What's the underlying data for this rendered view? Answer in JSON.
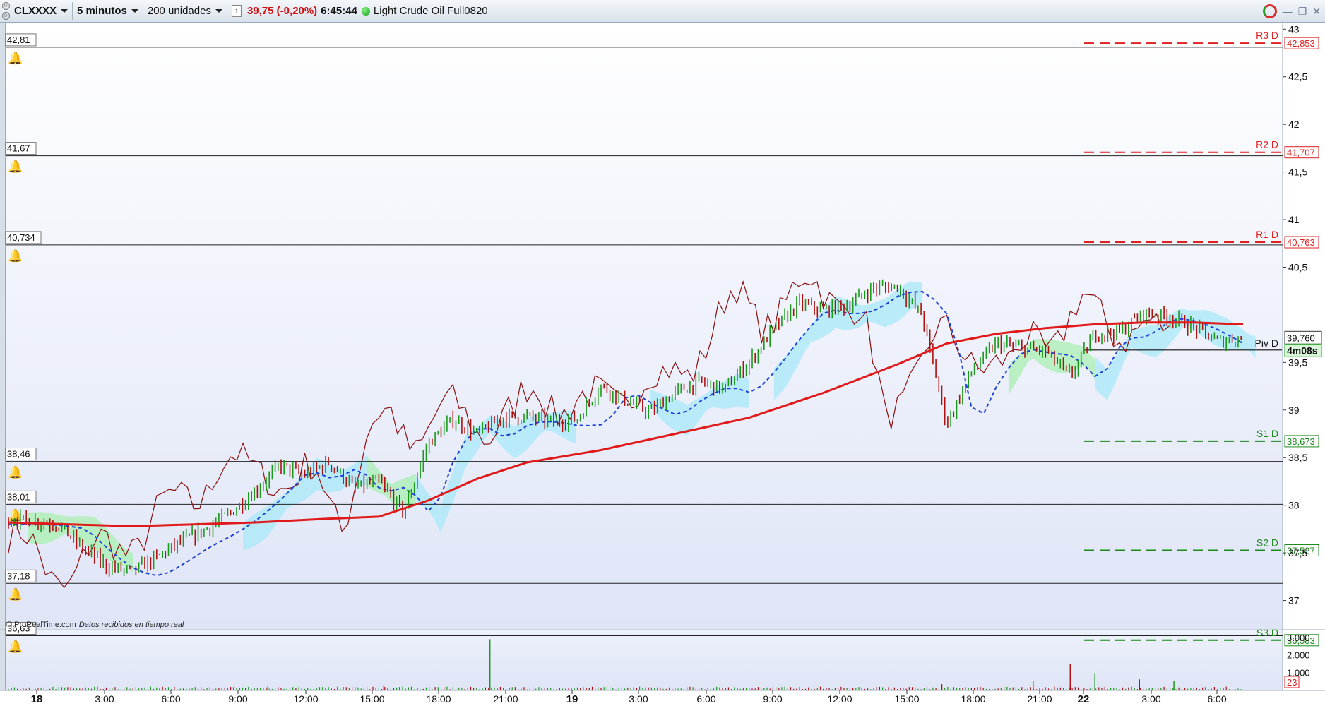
{
  "toolbar": {
    "instrument": "CLXXXX",
    "timeframe": "5 minutos",
    "units": "200 unidades",
    "info_icon": "i",
    "price_change": "39,75 (-0,20%)",
    "time": "6:45:44",
    "instrument_name": "Light Crude Oil Full0820"
  },
  "footer": {
    "copyright": "© ProRealTime.com",
    "realtime": "Datos recibidos en tiempo real"
  },
  "colors": {
    "candle_up": "#1a9a1a",
    "candle_down": "#b01010",
    "ma_200": "#e01a1a",
    "kijun": "#1a3fd8",
    "cloud_bull": "#a8efb0",
    "cloud_bear": "#a8e8f8",
    "resistance": "#e02020",
    "support": "#1a8a1a",
    "chikou": "#8a1010"
  },
  "chart_data": {
    "type": "line",
    "title": "",
    "xlabel": "",
    "ylabel": "",
    "ylim": [
      36.3,
      43.1
    ],
    "y_ticks": [
      "43",
      "42,5",
      "42",
      "41,5",
      "41",
      "40,5",
      "39,5",
      "39",
      "38,5",
      "38",
      "37,5",
      "37"
    ],
    "x_ticks": [
      "18",
      "3:00",
      "6:00",
      "9:00",
      "12:00",
      "15:00",
      "18:00",
      "21:00",
      "19",
      "3:00",
      "6:00",
      "9:00",
      "12:00",
      "15:00",
      "18:00",
      "21:00",
      "22",
      "3:00",
      "6:00"
    ],
    "x_bold_ticks": [
      "18",
      "19",
      "22"
    ],
    "alert_lines": [
      {
        "value": 42.81,
        "label": "42,81"
      },
      {
        "value": 41.67,
        "label": "41,67"
      },
      {
        "value": 40.734,
        "label": "40,734"
      },
      {
        "value": 38.46,
        "label": "38,46"
      },
      {
        "value": 38.01,
        "label": "38,01"
      },
      {
        "value": 37.18,
        "label": "37,18"
      },
      {
        "value": 36.63,
        "label": "36,63"
      }
    ],
    "pivot_levels": [
      {
        "name": "R3 D",
        "value": 42.853,
        "label": "42,853",
        "kind": "resistance"
      },
      {
        "name": "R2 D",
        "value": 41.707,
        "label": "41,707",
        "kind": "resistance"
      },
      {
        "name": "R1 D",
        "value": 40.763,
        "label": "40,763",
        "kind": "resistance"
      },
      {
        "name": "S1 D",
        "value": 38.673,
        "label": "38,673",
        "kind": "support"
      },
      {
        "name": "S2 D",
        "value": 37.527,
        "label": "37,527",
        "kind": "support"
      },
      {
        "name": "S3 D",
        "value": 36.583,
        "label": "36,583",
        "kind": "support"
      }
    ],
    "pivot": {
      "name": "Piv D",
      "value": 39.63
    },
    "current_price": {
      "value": 39.76,
      "label": "39,760"
    },
    "countdown": "4m08s",
    "price_series": [
      [
        0,
        37.85
      ],
      [
        1,
        37.84
      ],
      [
        2,
        37.8
      ],
      [
        3,
        37.55
      ],
      [
        4,
        37.36
      ],
      [
        5,
        37.3
      ],
      [
        6,
        37.45
      ],
      [
        7,
        37.62
      ],
      [
        8,
        37.75
      ],
      [
        9,
        37.92
      ],
      [
        10,
        38.15
      ],
      [
        11,
        38.42
      ],
      [
        12,
        38.32
      ],
      [
        13,
        38.45
      ],
      [
        14,
        38.18
      ],
      [
        15,
        38.25
      ],
      [
        16,
        37.92
      ],
      [
        17,
        38.65
      ],
      [
        18,
        38.9
      ],
      [
        19,
        38.75
      ],
      [
        20,
        38.92
      ],
      [
        21,
        38.93
      ],
      [
        22,
        38.88
      ],
      [
        23,
        38.9
      ],
      [
        24,
        39.25
      ],
      [
        25,
        39.1
      ],
      [
        26,
        38.98
      ],
      [
        27,
        39.18
      ],
      [
        28,
        39.3
      ],
      [
        29,
        39.22
      ],
      [
        30,
        39.5
      ],
      [
        31,
        39.85
      ],
      [
        32,
        40.12
      ],
      [
        33,
        40.05
      ],
      [
        34,
        40.1
      ],
      [
        35,
        40.28
      ],
      [
        36,
        40.3
      ],
      [
        37,
        40.0
      ],
      [
        38,
        38.85
      ],
      [
        39,
        39.4
      ],
      [
        40,
        39.7
      ],
      [
        41,
        39.65
      ],
      [
        42,
        39.62
      ],
      [
        43,
        39.35
      ],
      [
        44,
        39.8
      ],
      [
        45,
        39.82
      ],
      [
        46,
        40.02
      ],
      [
        47,
        39.98
      ],
      [
        48,
        39.87
      ],
      [
        49,
        39.72
      ],
      [
        50,
        39.76
      ]
    ],
    "ma_series": [
      [
        0,
        37.82
      ],
      [
        5,
        37.78
      ],
      [
        10,
        37.82
      ],
      [
        13,
        37.86
      ],
      [
        15,
        37.88
      ],
      [
        17,
        38.05
      ],
      [
        19,
        38.28
      ],
      [
        21,
        38.45
      ],
      [
        24,
        38.58
      ],
      [
        27,
        38.75
      ],
      [
        30,
        38.92
      ],
      [
        33,
        39.18
      ],
      [
        36,
        39.48
      ],
      [
        38,
        39.7
      ],
      [
        40,
        39.8
      ],
      [
        42,
        39.86
      ],
      [
        44,
        39.9
      ],
      [
        46,
        39.92
      ],
      [
        48,
        39.92
      ],
      [
        50,
        39.9
      ]
    ],
    "volume_axis": [
      "3.000",
      "2.000",
      "1.000"
    ],
    "volume_current": "23",
    "volume_spikes": [
      [
        10.5,
        180
      ],
      [
        15.2,
        250
      ],
      [
        19.5,
        2900
      ],
      [
        37.8,
        320
      ],
      [
        41.5,
        500
      ],
      [
        43.0,
        1500
      ],
      [
        44.0,
        950
      ],
      [
        45.8,
        600
      ],
      [
        47.2,
        520
      ]
    ]
  }
}
